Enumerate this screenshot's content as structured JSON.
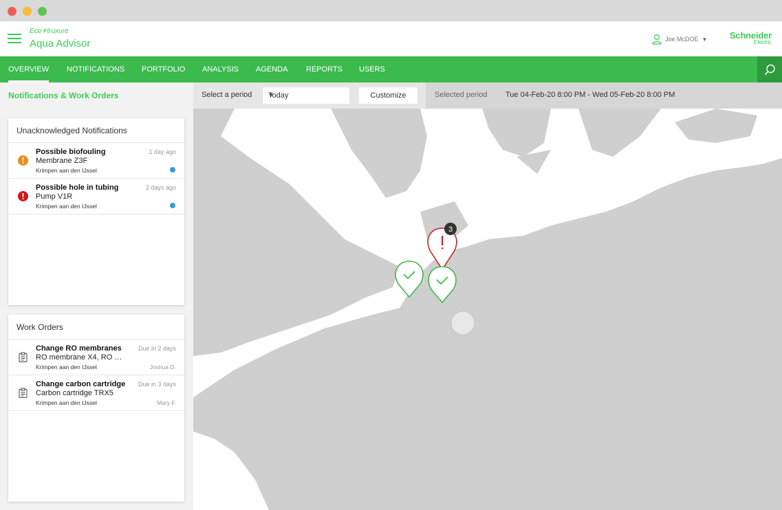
{
  "app": {
    "brand_top": "Eco✳truxure",
    "brand_main": "Aqua Advisor",
    "user_name": "Joe McDOE",
    "logo_line1": "Schneider",
    "logo_line2": "Electric"
  },
  "nav": {
    "tabs": [
      {
        "label": "OVERVIEW",
        "active": true
      },
      {
        "label": "NOTIFICATIONS",
        "active": false
      },
      {
        "label": "PORTFOLIO",
        "active": false
      },
      {
        "label": "ANALYSIS",
        "active": false
      },
      {
        "label": "AGENDA",
        "active": false
      },
      {
        "label": "REPORTS",
        "active": false
      },
      {
        "label": "USERS",
        "active": false
      }
    ]
  },
  "filters": {
    "section_title": "Notifications & Work Orders",
    "period_label": "Select a period",
    "period_value": "Today",
    "customize_label": "Customize",
    "selected_period_label": "Selected period",
    "selected_period_value": "Tue 04-Feb-20 8:00 PM - Wed 05-Feb-20 8:00 PM"
  },
  "notifications": {
    "title": "Unacknowledged Notifications",
    "items": [
      {
        "title": "Possible biofouling",
        "subtitle": "Membrane Z3F",
        "location": "Krimpen aan den IJssel",
        "ago": "1 day ago",
        "severity": "warning",
        "color": "#e8901c"
      },
      {
        "title": "Possible hole in tubing",
        "subtitle": "Pump V1R",
        "location": "Krimpen aan den IJssel",
        "ago": "2 days ago",
        "severity": "critical",
        "color": "#d0161c"
      }
    ]
  },
  "work_orders": {
    "title": "Work Orders",
    "items": [
      {
        "title": "Change RO membranes",
        "subtitle": "RO membrane X4, RO m...",
        "location": "Krimpen aan den IJssel",
        "due": "Due in 2 days",
        "assignee": "Joshua D."
      },
      {
        "title": "Change carbon cartridge",
        "subtitle": "Carbon cartridge TRX5",
        "location": "Krimpen aan den IJssel",
        "due": "Due in 3 days",
        "assignee": "Mary F."
      }
    ]
  },
  "map": {
    "alert_count": "3",
    "colors": {
      "land": "#cfcfcf",
      "water": "#ffffff",
      "alert": "#c8242b",
      "ok": "#3dba4e"
    }
  },
  "colors": {
    "accent": "#3dcd58",
    "nav_bg": "#3dba4e"
  }
}
